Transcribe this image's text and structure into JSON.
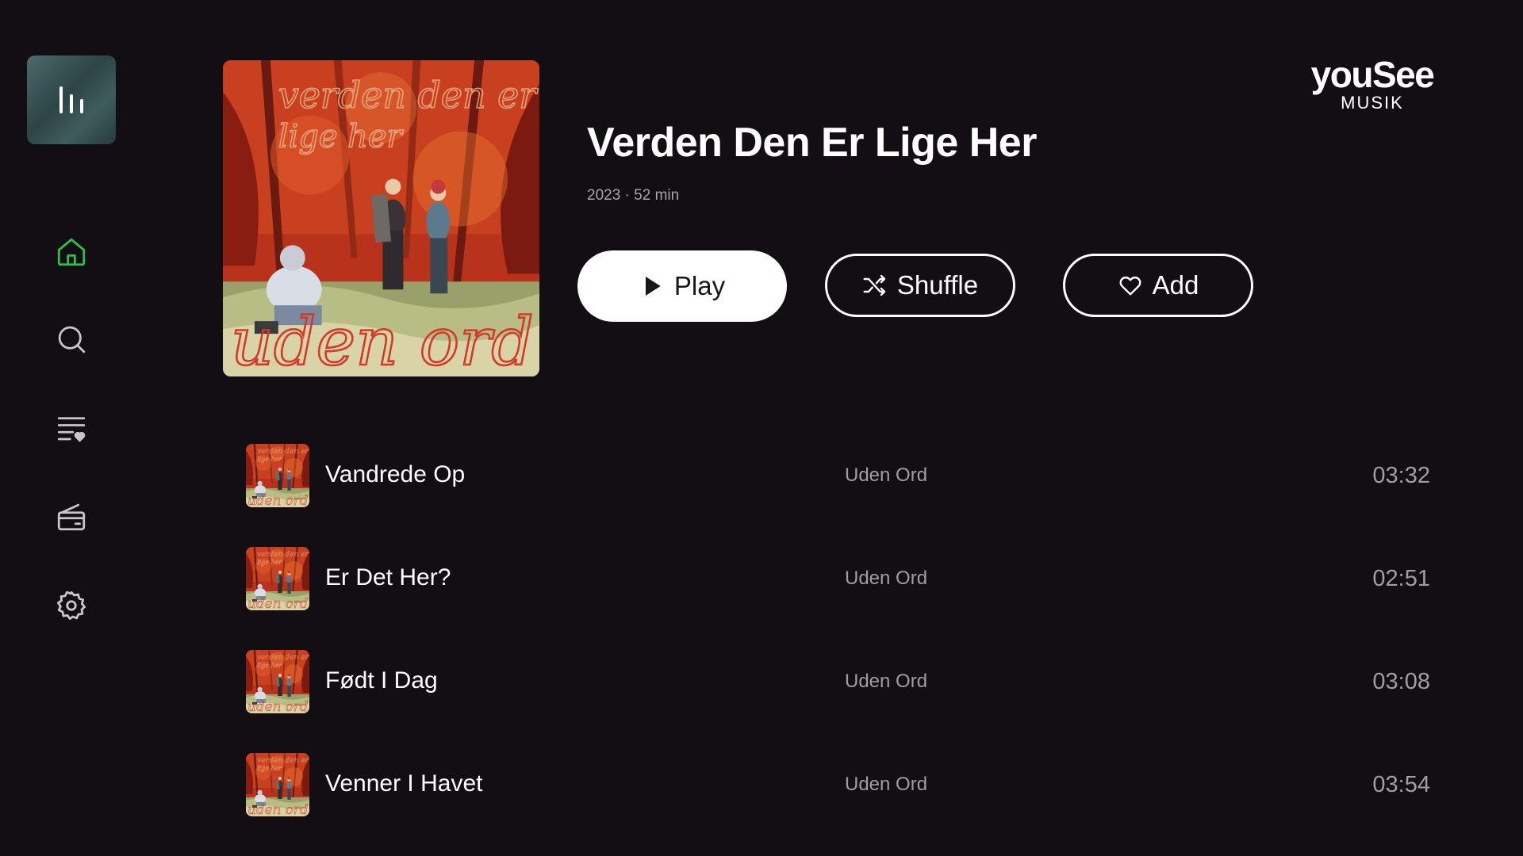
{
  "sidebar": {
    "now_playing_icon": "equalizer-bars-icon",
    "items": [
      {
        "id": "home",
        "icon": "home-icon",
        "active": true
      },
      {
        "id": "search",
        "icon": "search-icon",
        "active": false
      },
      {
        "id": "playlists",
        "icon": "playlist-heart-icon",
        "active": false
      },
      {
        "id": "radio",
        "icon": "radio-icon",
        "active": false
      },
      {
        "id": "settings",
        "icon": "gear-icon",
        "active": false
      }
    ]
  },
  "logo": {
    "main": "youSee",
    "sub": "MUSIK"
  },
  "album": {
    "title": "Verden Den Er Lige Her",
    "meta": "2023 · 52 min",
    "cover_text_top": "verden den er lige her",
    "cover_text_bottom": "uden ord"
  },
  "actions": {
    "play_label": "Play",
    "shuffle_label": "Shuffle",
    "add_label": "Add"
  },
  "tracks": [
    {
      "title": "Vandrede Op",
      "artist": "Uden Ord",
      "duration": "03:32"
    },
    {
      "title": "Er Det Her?",
      "artist": "Uden Ord",
      "duration": "02:51"
    },
    {
      "title": "Født I Dag",
      "artist": "Uden Ord",
      "duration": "03:08"
    },
    {
      "title": "Venner I Havet",
      "artist": "Uden Ord",
      "duration": "03:54"
    }
  ],
  "colors": {
    "background": "#120e13",
    "accent_active_nav": "#2fbf4a",
    "secondary_text": "#a19da2",
    "nav_icon": "#c9c6c9"
  }
}
